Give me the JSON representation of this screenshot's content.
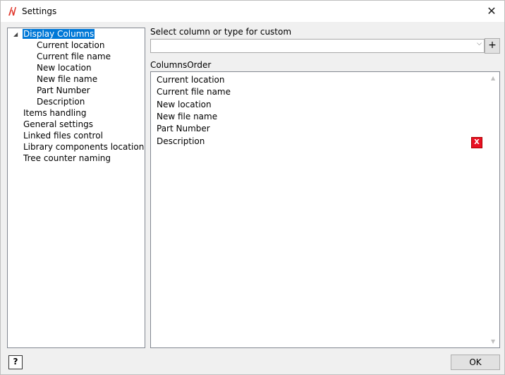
{
  "window": {
    "title": "Settings",
    "close_glyph": "✕"
  },
  "tree": {
    "items": [
      {
        "label": "Display Columns",
        "selected": true,
        "expanded": true,
        "children": [
          "Current location",
          "Current file name",
          "New location",
          "New file name",
          "Part Number",
          "Description"
        ]
      },
      {
        "label": "Items handling"
      },
      {
        "label": "General settings"
      },
      {
        "label": "Linked files control"
      },
      {
        "label": "Library components location"
      },
      {
        "label": "Tree counter naming"
      }
    ]
  },
  "column_select": {
    "label": "Select column or type for custom",
    "value": "",
    "add_label": "+"
  },
  "columns_order": {
    "label": "ColumnsOrder",
    "items": [
      "Current location",
      "Current file name",
      "New location",
      "New file name",
      "Part Number",
      "Description"
    ],
    "delete_label": "X"
  },
  "footer": {
    "help_label": "?",
    "ok_label": "OK"
  },
  "colors": {
    "accent": "#0078d7",
    "delete": "#e81123",
    "logo": "#e03a2f"
  }
}
